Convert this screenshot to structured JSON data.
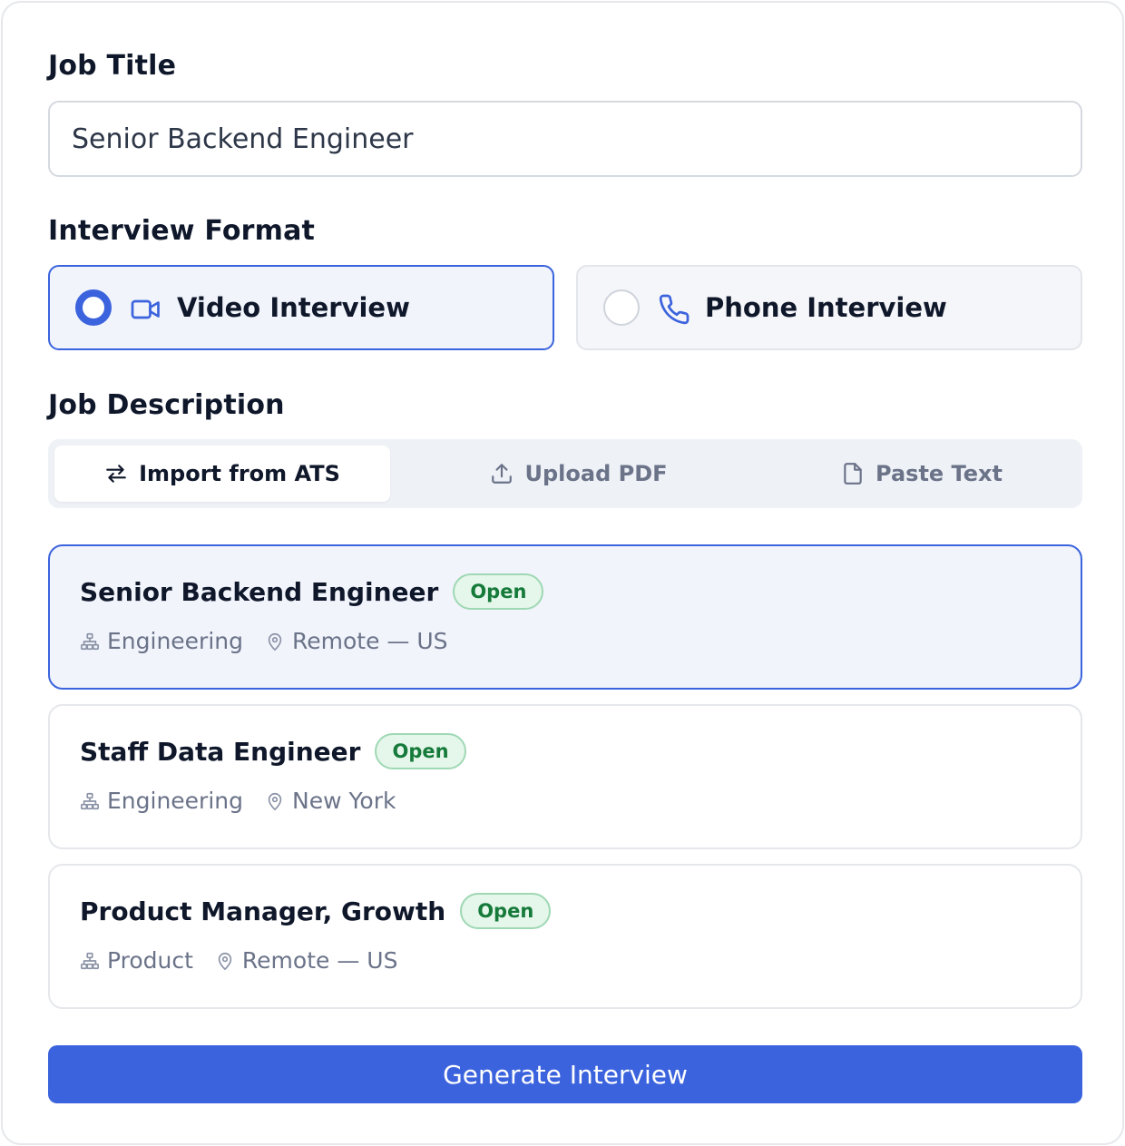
{
  "form": {
    "job_title_label": "Job Title",
    "job_title_value": "Senior Backend Engineer",
    "format_label": "Interview Format",
    "formats": [
      {
        "label": "Video Interview",
        "icon": "video-icon",
        "selected": true
      },
      {
        "label": "Phone Interview",
        "icon": "phone-icon",
        "selected": false
      }
    ],
    "description_label": "Job Description",
    "tabs": [
      {
        "label": "Import from ATS",
        "icon": "swap-arrows-icon",
        "active": true
      },
      {
        "label": "Upload PDF",
        "icon": "upload-icon",
        "active": false
      },
      {
        "label": "Paste Text",
        "icon": "file-icon",
        "active": false
      }
    ],
    "jobs": [
      {
        "title": "Senior Backend Engineer",
        "status": "Open",
        "department": "Engineering",
        "location": "Remote — US",
        "selected": true
      },
      {
        "title": "Staff Data Engineer",
        "status": "Open",
        "department": "Engineering",
        "location": "New York",
        "selected": false
      },
      {
        "title": "Product Manager, Growth",
        "status": "Open",
        "department": "Product",
        "location": "Remote — US",
        "selected": false
      }
    ],
    "submit_label": "Generate Interview"
  },
  "colors": {
    "accent": "#3b63dd",
    "selected_bg": "#f1f4fb",
    "badge_text": "#157a3a",
    "badge_bg": "#e5f6ea"
  }
}
